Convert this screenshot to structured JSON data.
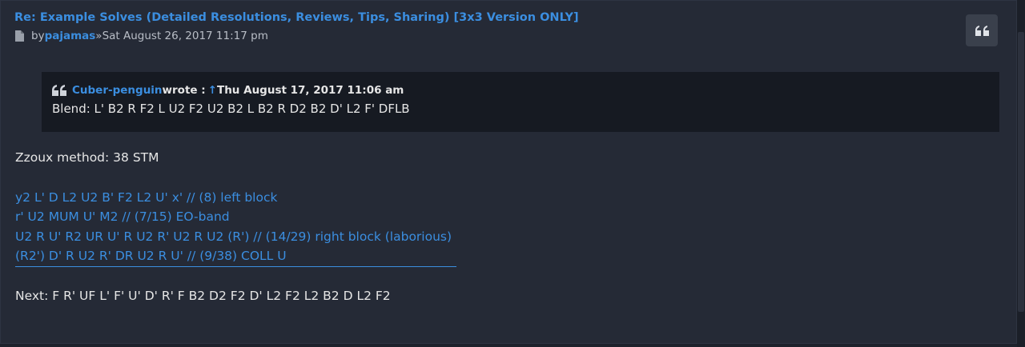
{
  "post": {
    "title": "Re: Example Solves (Detailed Resolutions, Reviews, Tips, Sharing) [3x3 Version ONLY]",
    "by": "by",
    "author": "pajamas",
    "separator": "»",
    "date": "Sat August 26, 2017 11:17 pm",
    "quote_button_icon": "quote-icon"
  },
  "quote": {
    "author": "Cuber-penguin",
    "wrote": "wrote :",
    "arrow": "↑",
    "date": "Thu August 17, 2017 11:06 am",
    "text": "Blend: L' B2 R F2 L U2 F2 U2 B2 L B2 R D2 B2 D' L2 F' DFLB"
  },
  "body": {
    "method": "Zzoux method: 38 STM",
    "solution_lines": [
      "y2 L' D L2 U2 B' F2 L2 U' x' // (8) left block",
      "r' U2 MUM U' M2 // (7/15) EO-band",
      "U2 R U' R2 UR U' R U2 R' U2 R U2 (R') // (14/29) right block (laborious)",
      "(R2') D' R U2 R' DR U2 R U' // (9/38) COLL U"
    ],
    "next": "Next: F R' UF L' F' U' D' R' F B2 D2 F2 D' L2 F2 L2 B2 D L2 F2"
  },
  "colors": {
    "link": "#3b8ee0",
    "background": "#252a36",
    "quote_bg": "#161a22"
  }
}
